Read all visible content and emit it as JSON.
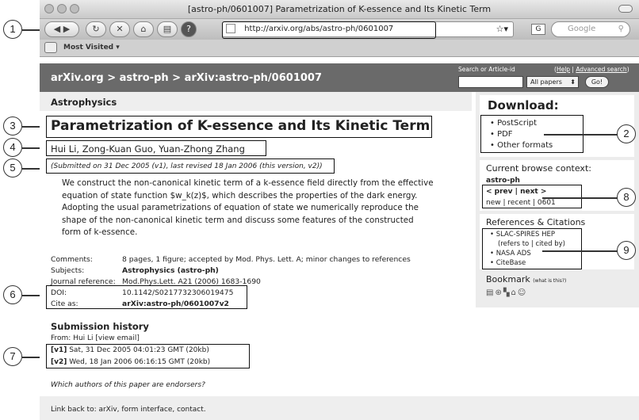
{
  "window": {
    "title": "[astro-ph/0601007] Parametrization of K-essence and Its Kinetic Term"
  },
  "toolbar": {
    "url": "http://arxiv.org/abs/astro-ph/0601007",
    "search_placeholder": "Google",
    "search_engine_icon": "G"
  },
  "bookmarks": {
    "most_visited": "Most Visited ▾"
  },
  "header": {
    "breadcrumb": "arXiv.org > astro-ph > arXiv:astro-ph/0601007",
    "search_label": "Search or Article-id",
    "help": "Help",
    "sep": " | ",
    "advanced": "Advanced search",
    "scope": "All papers",
    "go": "Go!"
  },
  "subject": "Astrophysics",
  "paper": {
    "title": "Parametrization of K-essence and Its Kinetic Term",
    "authors": "Hui Li, Zong-Kuan Guo, Yuan-Zhong Zhang",
    "submitted": "(Submitted on 31 Dec 2005 (v1), last revised 18 Jan 2006 (this version, v2))",
    "abstract": "We construct the non-canonical kinetic term of a k-essence field directly from the effective equation of state function $w_k(z)$, which describes the properties of the dark energy. Adopting the usual parametrizations of equation of state we numerically reproduce the shape of the non-canonical kinetic term and discuss some features of the constructed form of k-essence."
  },
  "meta": [
    {
      "label": "Comments:",
      "value": "8 pages, 1 figure; accepted by Mod. Phys. Lett. A; minor changes to references"
    },
    {
      "label": "Subjects:",
      "value": "Astrophysics (astro-ph)"
    },
    {
      "label": "Journal reference:",
      "value": "Mod.Phys.Lett. A21 (2006) 1683-1690"
    },
    {
      "label": "DOI:",
      "value": "10.1142/S0217732306019475"
    },
    {
      "label": "Cite as:",
      "value": "arXiv:astro-ph/0601007v2"
    }
  ],
  "history": {
    "heading": "Submission history",
    "from": "From: Hui Li [view email]",
    "v1_tag": "[v1]",
    "v1": " Sat, 31 Dec 2005 04:01:23 GMT (20kb)",
    "v2_tag": "[v2]",
    "v2": " Wed, 18 Jan 2006 06:16:15 GMT (20kb)",
    "endorsers": "Which authors of this paper are endorsers?"
  },
  "footer": "Link back to: arXiv, form interface, contact.",
  "download": {
    "heading": "Download:",
    "items": [
      "PostScript",
      "PDF",
      "Other formats"
    ]
  },
  "browse": {
    "heading": "Current browse context:",
    "context": "astro-ph",
    "prev": "< prev",
    "pipe": " | ",
    "next": "next >",
    "links": "new | recent | 0601"
  },
  "refs": {
    "heading": "References & Citations",
    "slac": "SLAC-SPIRES HEP",
    "slac_sub": "(refers to | cited by)",
    "nasa": "NASA ADS",
    "cite": "CiteBase"
  },
  "bookmark": {
    "heading": "Bookmark",
    "whatis": "(what is this?)"
  },
  "callouts": [
    "1",
    "2",
    "3",
    "4",
    "5",
    "6",
    "7",
    "8",
    "9"
  ]
}
